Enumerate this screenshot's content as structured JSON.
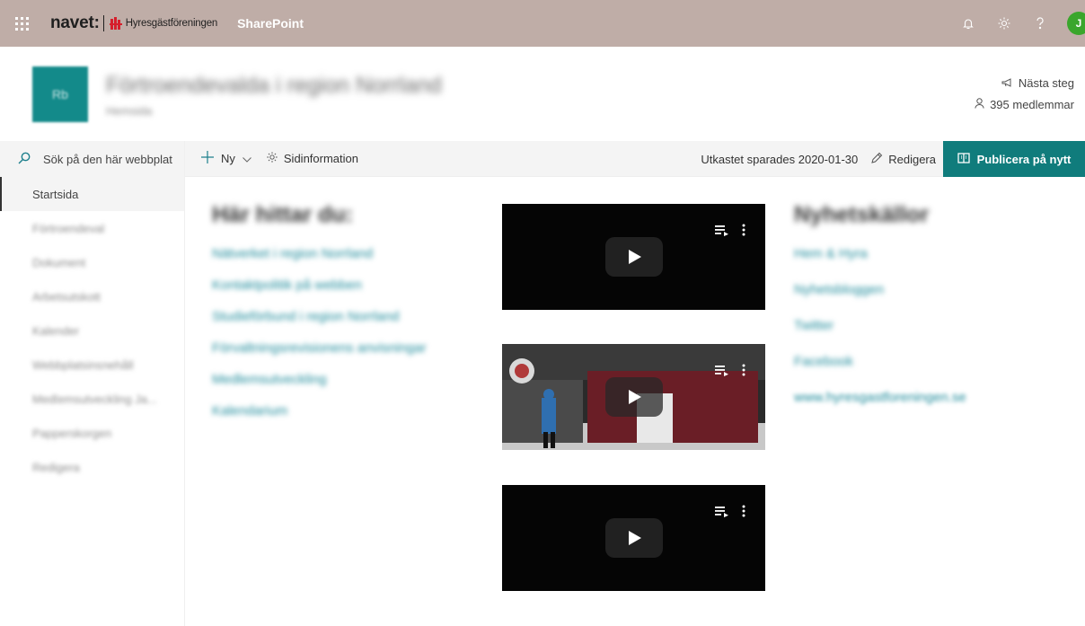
{
  "suitebar": {
    "brand_name": "navet:",
    "brand_org": "Hyresgästföreningen",
    "app_name": "SharePoint",
    "avatar_initial": "J",
    "bg_color": "#bfada7",
    "icons": [
      "waffle-icon",
      "bell-icon",
      "gear-icon",
      "help-icon"
    ]
  },
  "site": {
    "logo_text": "Rb",
    "title": "Förtroendevalda i region Norrland",
    "subtitle": "Hemsida",
    "next_steps": "Nästa steg",
    "members": "395 medlemmar"
  },
  "command_bar": {
    "new_label": "Ny",
    "page_info_label": "Sidinformation",
    "saved_text": "Utkastet sparades 2020-01-30",
    "edit_label": "Redigera",
    "publish_label": "Publicera på nytt",
    "accent_color": "#107c7c"
  },
  "leftnav": {
    "search_placeholder": "Sök på den här webbplat",
    "items": [
      {
        "label": "Startsida"
      },
      {
        "label": "Förtroendeval"
      },
      {
        "label": "Dokument"
      },
      {
        "label": "Arbetsutskott"
      },
      {
        "label": "Kalender"
      },
      {
        "label_blur": "Webbplatsins",
        "label_clear": "nehåll"
      },
      {
        "label_clear": "Medl",
        "label_blur": "emsutveck",
        "label_tail": "ling Ja..."
      },
      {
        "label": "Papperskorgen"
      },
      {
        "label": "Redigera"
      }
    ]
  },
  "main": {
    "left_heading": "Här hittar du:",
    "left_links": [
      "Nätverket i region Norrland",
      "Kontaktpolitik på webben",
      "Studieförbund i region Norrland",
      "Förvaltningsrevisionens anvisningar",
      "Medlemsutveckling",
      "Kalendarium"
    ],
    "right_heading": "Nyhetskällor",
    "right_links": [
      "Hem & Hyra",
      "Nyhetsbloggen",
      "Twitter",
      "Facebook",
      "www.hyresgastforeningen.se"
    ]
  }
}
